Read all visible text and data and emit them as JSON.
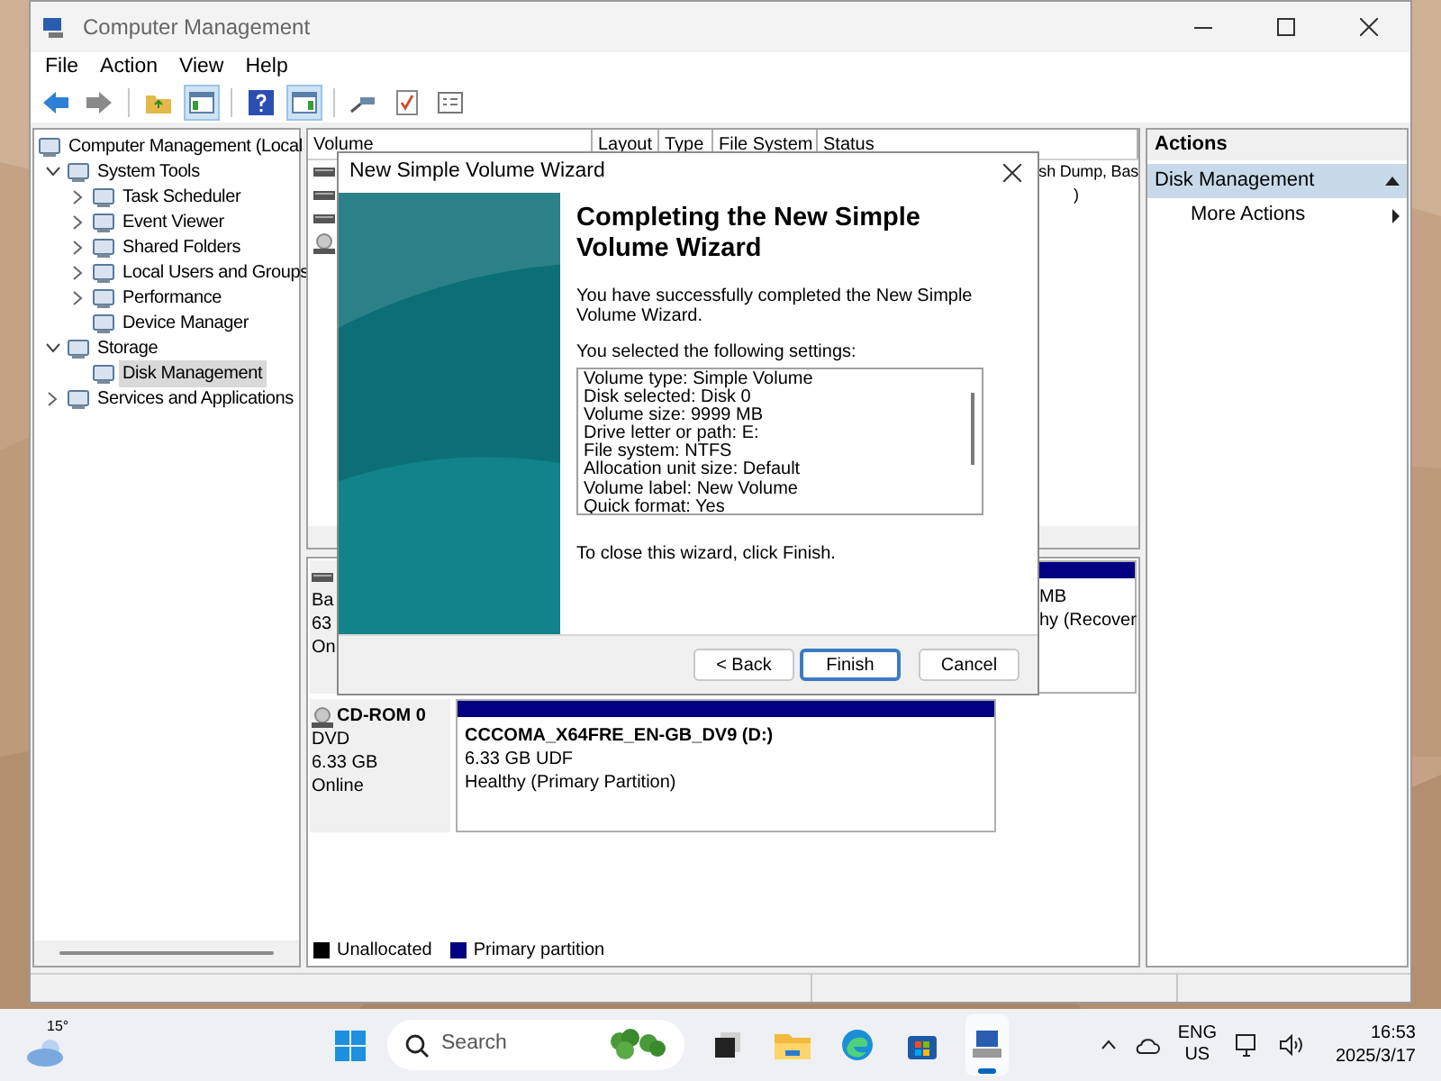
{
  "window": {
    "title": "Computer Management"
  },
  "menu": [
    "File",
    "Action",
    "View",
    "Help"
  ],
  "toolbar": [
    {
      "kind": "back"
    },
    {
      "kind": "forward"
    },
    {
      "kind": "sep"
    },
    {
      "kind": "up"
    },
    {
      "kind": "tree",
      "on": true
    },
    {
      "kind": "sep"
    },
    {
      "kind": "help"
    },
    {
      "kind": "pane",
      "on": true
    },
    {
      "kind": "sep"
    },
    {
      "kind": "connect"
    },
    {
      "kind": "export"
    },
    {
      "kind": "properties"
    }
  ],
  "tree": [
    {
      "label": "Computer Management (Local",
      "selected": false,
      "children": [
        {
          "label": "System Tools",
          "expanded": true,
          "selected": false,
          "children": [
            {
              "label": "Task Scheduler",
              "expanded": false,
              "selected": false
            },
            {
              "label": "Event Viewer",
              "expanded": false,
              "selected": false
            },
            {
              "label": "Shared Folders",
              "expanded": false,
              "selected": false
            },
            {
              "label": "Local Users and Groups",
              "expanded": false,
              "selected": false
            },
            {
              "label": "Performance",
              "expanded": false,
              "selected": false
            },
            {
              "label": "Device Manager",
              "selected": false
            }
          ]
        },
        {
          "label": "Storage",
          "expanded": true,
          "selected": false,
          "children": [
            {
              "label": "Disk Management",
              "selected": true
            }
          ]
        },
        {
          "label": "Services and Applications",
          "expanded": false,
          "selected": false
        }
      ]
    }
  ],
  "volume_table": {
    "columns": [
      "Volume",
      "Layout",
      "Type",
      "File System",
      "Status"
    ],
    "rows": [
      {
        "kind": "disk",
        "status": "sh Dump, Bas"
      },
      {
        "kind": "disk",
        "status": ")"
      },
      {
        "kind": "disk"
      },
      {
        "kind": "cdrom"
      }
    ]
  },
  "disks": [
    {
      "kind": "disk",
      "lines": [
        "Ba",
        "63",
        "On"
      ],
      "partitions": [
        {
          "lines": [
            "MB",
            "hy (Recover"
          ]
        }
      ]
    },
    {
      "kind": "cdrom",
      "name": "CD-ROM 0",
      "lines": [
        "DVD",
        "6.33 GB",
        "Online"
      ],
      "partitions": [
        {
          "title": "CCCOMA_X64FRE_EN-GB_DV9  (D:)",
          "lines": [
            "6.33 GB UDF",
            "Healthy (Primary Partition)"
          ]
        }
      ]
    }
  ],
  "legend": [
    {
      "label": "Unallocated",
      "color": "#000000"
    },
    {
      "label": "Primary partition",
      "color": "#000080"
    }
  ],
  "actions": {
    "title": "Actions",
    "section": {
      "label": "Disk Management",
      "expanded": true
    },
    "items": [
      {
        "label": "More Actions"
      }
    ]
  },
  "wizard": {
    "title": "New Simple Volume Wizard",
    "heading": "Completing the New Simple Volume Wizard",
    "intro": "You have successfully completed the New Simple Volume Wizard.",
    "settings_label": "You selected the following settings:",
    "settings": [
      "Volume type: Simple Volume",
      "Disk selected: Disk 0",
      "Volume size: 9999 MB",
      "Drive letter or path: E:",
      "File system: NTFS",
      "Allocation unit size: Default",
      "Volume label: New Volume",
      "Quick format: Yes"
    ],
    "closing": "To close this wizard, click Finish.",
    "buttons": [
      {
        "label": "< Back",
        "default": false
      },
      {
        "label": "Finish",
        "default": true
      },
      {
        "label": "Cancel",
        "default": false
      }
    ]
  },
  "taskbar": {
    "weather": "15°",
    "search_placeholder": "Search",
    "apps": [
      {
        "kind": "taskview",
        "active": false
      },
      {
        "kind": "explorer",
        "active": false
      },
      {
        "kind": "browser",
        "active": false
      },
      {
        "kind": "store",
        "active": false
      },
      {
        "kind": "compmgmt",
        "active": true
      }
    ],
    "language": "ENG",
    "region": "US",
    "time": "16:53",
    "date": "2025/3/17"
  }
}
